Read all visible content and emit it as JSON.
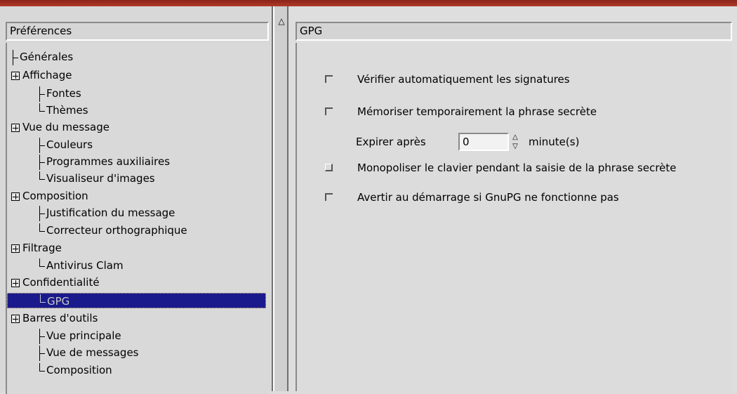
{
  "sidebar": {
    "header": "Préférences",
    "items": [
      {
        "label": "Générales"
      },
      {
        "label": "Affichage"
      },
      {
        "label": "Fontes"
      },
      {
        "label": "Thèmes"
      },
      {
        "label": "Vue du message"
      },
      {
        "label": "Couleurs"
      },
      {
        "label": "Programmes auxiliaires"
      },
      {
        "label": "Visualiseur d'images"
      },
      {
        "label": "Composition"
      },
      {
        "label": "Justification du message"
      },
      {
        "label": "Correcteur orthographique"
      },
      {
        "label": "Filtrage"
      },
      {
        "label": "Antivirus Clam"
      },
      {
        "label": "Confidentialité"
      },
      {
        "label": "GPG"
      },
      {
        "label": "Barres d'outils"
      },
      {
        "label": "Vue principale"
      },
      {
        "label": "Vue de messages"
      },
      {
        "label": "Composition"
      }
    ],
    "selected": "GPG"
  },
  "panel": {
    "title": "GPG",
    "options": [
      {
        "label": "Vérifier automatiquement les signatures",
        "checked": false
      },
      {
        "label": "Mémoriser temporairement la phrase secrète",
        "checked": false
      },
      {
        "label": "Monopoliser le clavier pendant la saisie de la phrase secrète",
        "checked": false
      },
      {
        "label": "Avertir au démarrage si GnuPG ne fonctionne pas",
        "checked": false
      }
    ],
    "expire": {
      "label": "Expirer après",
      "value": "0",
      "unit": "minute(s)"
    }
  }
}
